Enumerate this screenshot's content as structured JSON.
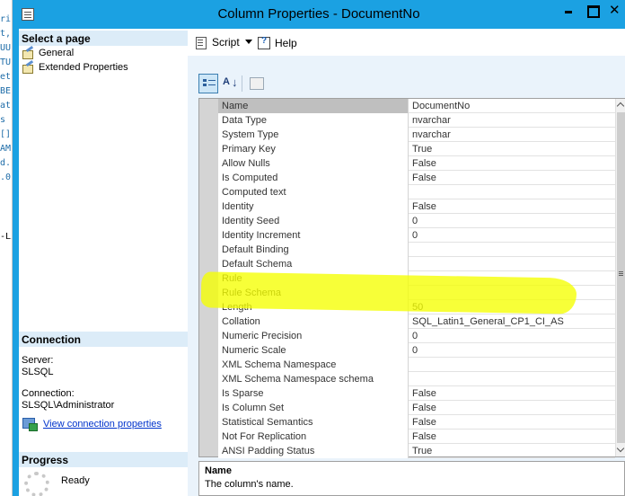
{
  "background_editor": {
    "lines": [
      "ri",
      "t,",
      "UU",
      "TU",
      "et",
      "BE",
      "at",
      "s",
      "[]",
      "AM",
      "d.",
      ".0"
    ],
    "status_line": "-Lin"
  },
  "window": {
    "title": "Column Properties - DocumentNo",
    "close_glyph": "✕"
  },
  "left_panel": {
    "select_page_header": "Select a page",
    "pages": [
      {
        "label": "General",
        "icon": "wrench-page-icon"
      },
      {
        "label": "Extended Properties",
        "icon": "wrench-page-icon"
      }
    ],
    "connection": {
      "header": "Connection",
      "server_label": "Server:",
      "server_value": "SLSQL",
      "connection_label": "Connection:",
      "connection_value": "SLSQL\\Administrator",
      "view_link": "View connection properties"
    },
    "progress": {
      "header": "Progress",
      "status": "Ready"
    }
  },
  "toolbar": {
    "script_label": "Script",
    "help_label": "Help"
  },
  "grid_toolbar": {
    "categorized_icon": "categorized-icon",
    "alpha_label": "A",
    "alpha_z": "Z",
    "alpha_arrow": "↓",
    "property_pages_icon": "property-pages-icon"
  },
  "properties": [
    {
      "name": "Name",
      "value": "DocumentNo"
    },
    {
      "name": "Data Type",
      "value": "nvarchar"
    },
    {
      "name": "System Type",
      "value": "nvarchar"
    },
    {
      "name": "Primary Key",
      "value": "True"
    },
    {
      "name": "Allow Nulls",
      "value": "False"
    },
    {
      "name": "Is Computed",
      "value": "False"
    },
    {
      "name": "Computed text",
      "value": ""
    },
    {
      "name": "Identity",
      "value": "False"
    },
    {
      "name": "Identity Seed",
      "value": "0"
    },
    {
      "name": "Identity Increment",
      "value": "0"
    },
    {
      "name": "Default Binding",
      "value": ""
    },
    {
      "name": "Default Schema",
      "value": ""
    },
    {
      "name": "Rule",
      "value": ""
    },
    {
      "name": "Rule Schema",
      "value": ""
    },
    {
      "name": "Length",
      "value": "50"
    },
    {
      "name": "Collation",
      "value": "SQL_Latin1_General_CP1_CI_AS"
    },
    {
      "name": "Numeric Precision",
      "value": "0"
    },
    {
      "name": "Numeric Scale",
      "value": "0"
    },
    {
      "name": "XML Schema Namespace",
      "value": ""
    },
    {
      "name": "XML Schema Namespace schema",
      "value": ""
    },
    {
      "name": "Is Sparse",
      "value": "False"
    },
    {
      "name": "Is Column Set",
      "value": "False"
    },
    {
      "name": "Statistical Semantics",
      "value": "False"
    },
    {
      "name": "Not For Replication",
      "value": "False"
    },
    {
      "name": "ANSI Padding Status",
      "value": "True"
    }
  ],
  "selected_property": "Name",
  "highlight_color": "#f5ff00",
  "description": {
    "title": "Name",
    "text": "The column's name."
  }
}
